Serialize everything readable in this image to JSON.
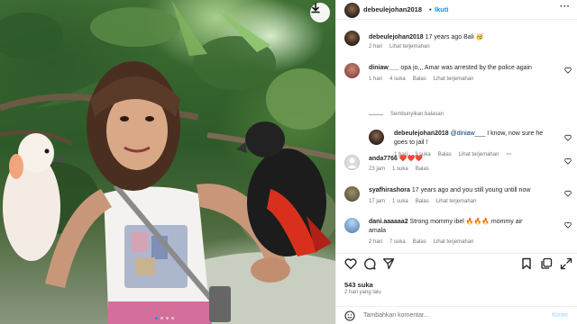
{
  "post": {
    "username": "debeulejohan2018",
    "follow_label": "Ikuti",
    "caption_user": "debeulejohan2018",
    "caption_text": "17 years ago Bali 🥳",
    "caption_time": "2 hari",
    "caption_translate": "Lihat terjemahan",
    "likes": "543 suka",
    "posted_time": "2 hari yang lalu",
    "comment_placeholder": "Tambahkan komentar...",
    "post_label": "Kirim",
    "carousel": {
      "count": 4,
      "active_index": 1
    }
  },
  "comments": [
    {
      "user": "diniaw___",
      "text": "opa jo,,, Amar was arrested by the police again",
      "time": "1 hari",
      "likes": "4 suka",
      "reply": "Balas",
      "translate": "Lihat terjemahan",
      "hide_replies": "Sembunyikan balasan",
      "replies": [
        {
          "user": "debeulejohan2018",
          "mention": "@diniaw___",
          "text_line1": "I know, now sure he",
          "text_line2": "goes to jail !",
          "time": "1 hari",
          "likes": "3 suka",
          "reply": "Balas",
          "translate": "Lihat terjemahan"
        }
      ]
    },
    {
      "user": "anda7766",
      "text": "❤️❤️❤️",
      "time": "23 jam",
      "likes": "1 suka",
      "reply": "Balas"
    },
    {
      "user": "syafhirashora",
      "text": "17 years ago and you still young untill now",
      "time": "17 jam",
      "likes": "1 suka",
      "reply": "Balas",
      "translate": "Lihat terjemahan"
    },
    {
      "user": "dani.aaaaaa2",
      "text_line1": "Strong mommy ibel 🔥🔥🔥 mommy air",
      "text_line2": "amala",
      "time": "2 hari",
      "likes": "7 suka",
      "reply": "Balas",
      "translate": "Lihat terjemahan"
    }
  ],
  "icons": {
    "download": "download-icon",
    "more": "more-icon",
    "heart": "heart-icon",
    "comment": "comment-icon",
    "share": "share-icon",
    "bookmark": "bookmark-icon",
    "multi": "multiple-posts-icon",
    "emoji": "emoji-icon",
    "user": "user-icon"
  },
  "colors": {
    "accent": "#0095f6",
    "muted": "#737373",
    "text": "#262626"
  }
}
